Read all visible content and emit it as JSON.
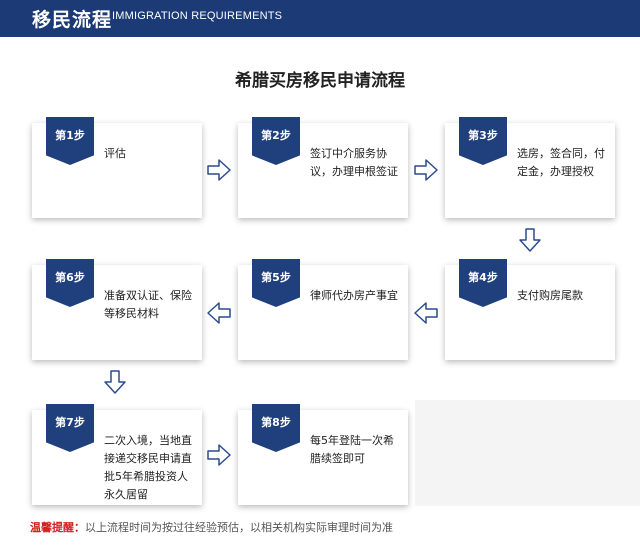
{
  "header": {
    "title_cn": "移民流程",
    "title_en": "IMMIGRATION REQUIREMENTS"
  },
  "main_title": "希腊买房移民申请流程",
  "steps": [
    {
      "badge": "第1步",
      "text": "评估"
    },
    {
      "badge": "第2步",
      "text": "签订中介服务协议，办理申根签证"
    },
    {
      "badge": "第3步",
      "text": "选房，签合同，付定金，办理授权"
    },
    {
      "badge": "第4步",
      "text": "支付购房尾款"
    },
    {
      "badge": "第5步",
      "text": "律师代办房产事宜"
    },
    {
      "badge": "第6步",
      "text": "准备双认证、保险等移民材料"
    },
    {
      "badge": "第7步",
      "text": "二次入境，当地直接递交移民申请直批5年希腊投资人永久居留"
    },
    {
      "badge": "第8步",
      "text": "每5年登陆一次希腊续签即可"
    }
  ],
  "note": {
    "label": "温馨提醒：",
    "text": "以上流程时间为按过往经验预估，以相关机构实际审理时间为准"
  },
  "colors": {
    "header_bg": "#1b3a76",
    "badge_bg": "#1f3f7d",
    "arrow_stroke": "#2b4c8c",
    "note_label": "#d12020"
  },
  "icons": {
    "right": "arrow-right-icon",
    "left": "arrow-left-icon",
    "down": "arrow-down-icon"
  }
}
